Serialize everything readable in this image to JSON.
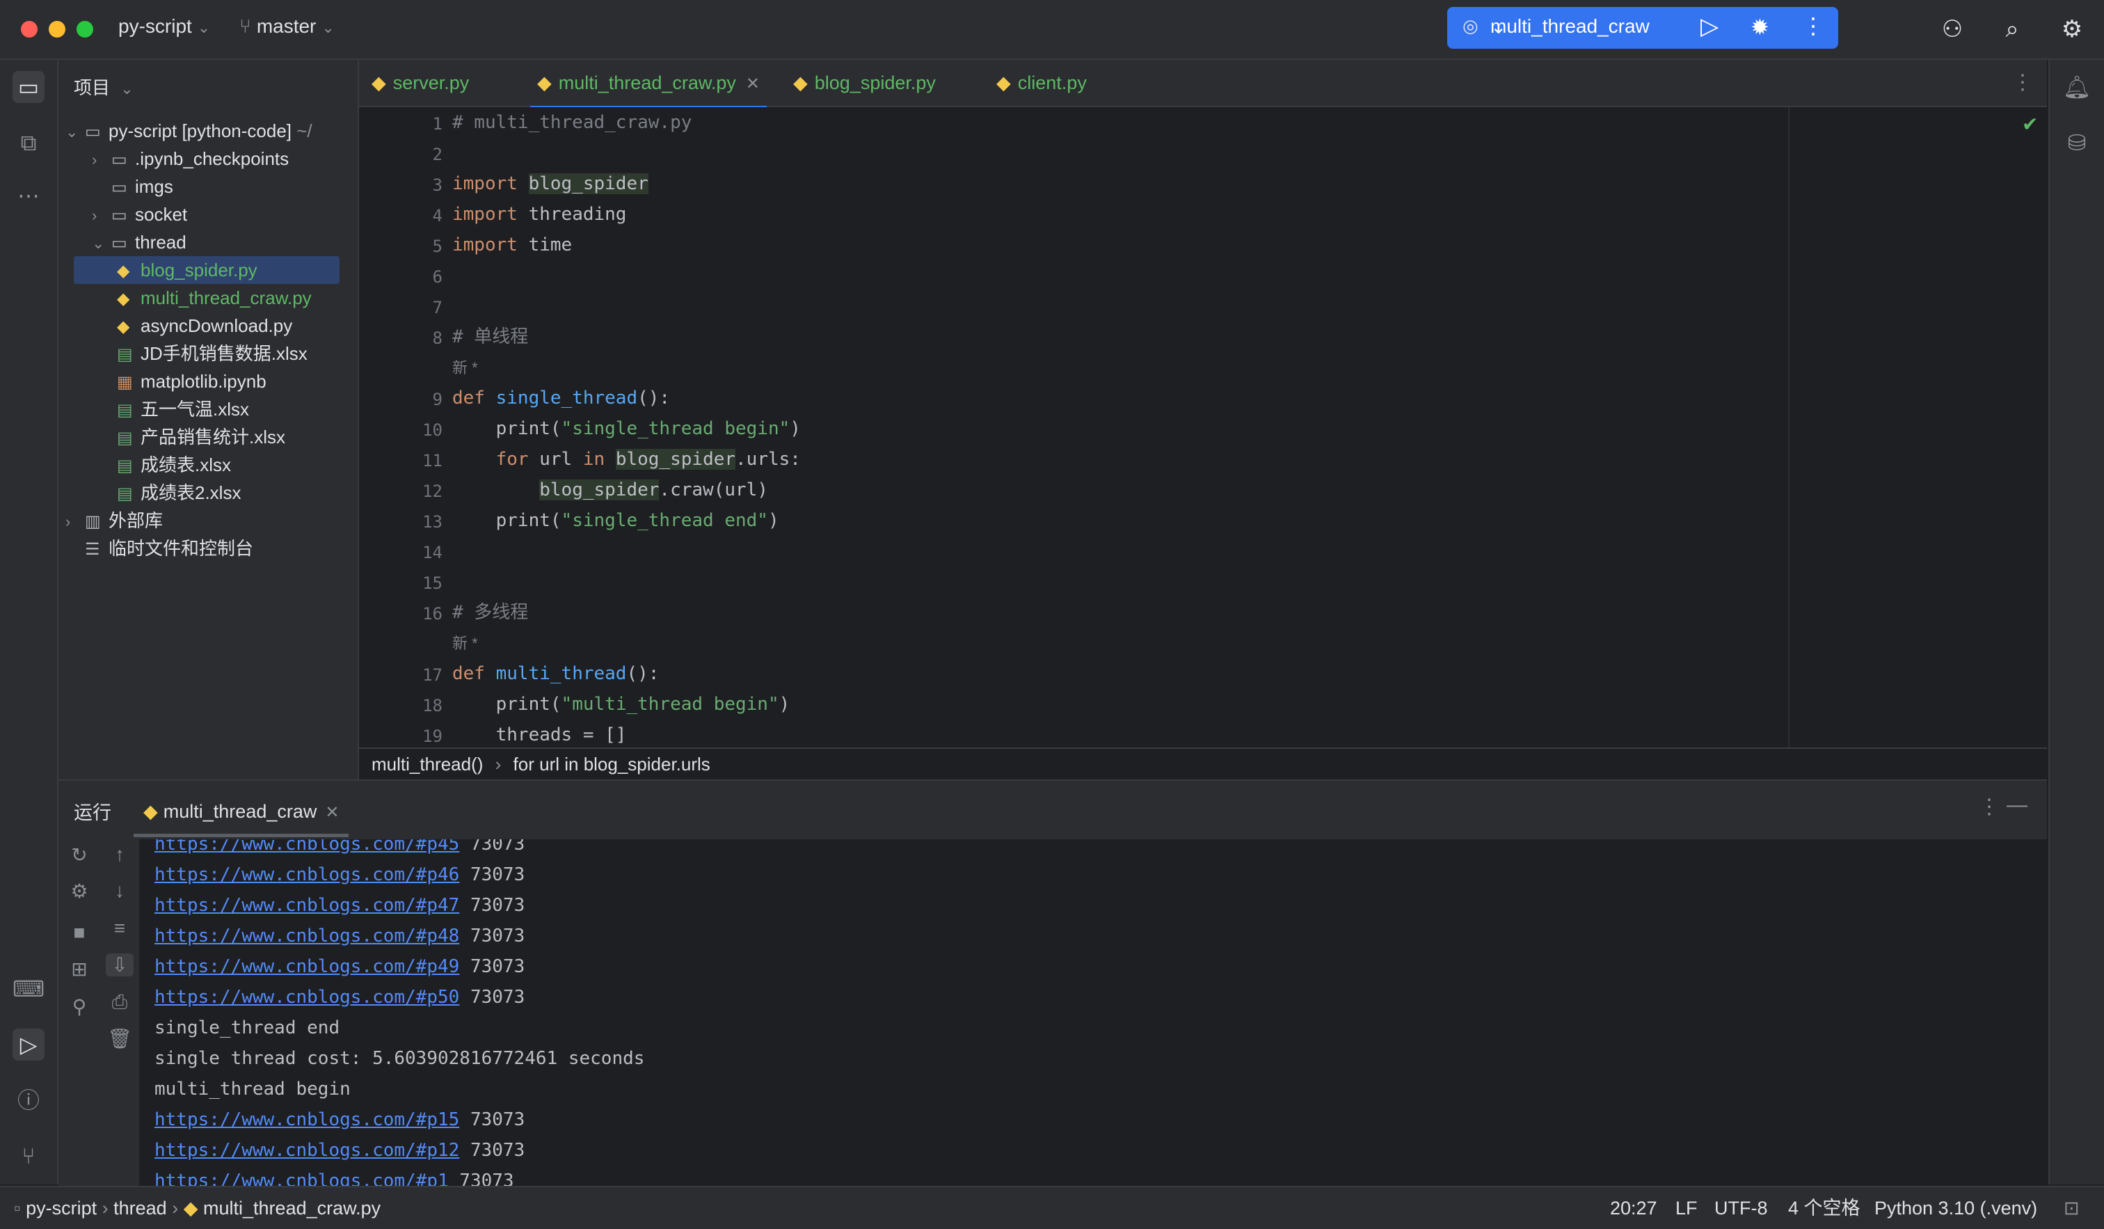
{
  "titlebar": {
    "project": "py-script",
    "branch": "master",
    "run_config": "multi_thread_craw"
  },
  "project_panel": {
    "title": "项目",
    "root_label": "py-script [python-code]",
    "root_suffix": "~/",
    "items": [
      {
        "label": ".ipynb_checkpoints"
      },
      {
        "label": "imgs"
      },
      {
        "label": "socket"
      },
      {
        "label": "thread"
      },
      {
        "label": "blog_spider.py"
      },
      {
        "label": "multi_thread_craw.py"
      },
      {
        "label": "asyncDownload.py"
      },
      {
        "label": "JD手机销售数据.xlsx"
      },
      {
        "label": "matplotlib.ipynb"
      },
      {
        "label": "五一气温.xlsx"
      },
      {
        "label": "产品销售统计.xlsx"
      },
      {
        "label": "成绩表.xlsx"
      },
      {
        "label": "成绩表2.xlsx"
      },
      {
        "label": "外部库"
      },
      {
        "label": "临时文件和控制台"
      }
    ]
  },
  "tabs": [
    {
      "label": "server.py"
    },
    {
      "label": "multi_thread_craw.py"
    },
    {
      "label": "blog_spider.py"
    },
    {
      "label": "client.py"
    }
  ],
  "editor": {
    "line_numbers": [
      "1",
      "2",
      "3",
      "4",
      "5",
      "6",
      "7",
      "8",
      "9",
      "10",
      "11",
      "12",
      "13",
      "14",
      "15",
      "16",
      "17",
      "18",
      "19"
    ],
    "hint": "新 *",
    "breadcrumb_func": "multi_thread()",
    "breadcrumb_stmt": "for url in blog_spider.urls"
  },
  "run_panel": {
    "title": "运行",
    "tab_label": "multi_thread_craw",
    "console": [
      {
        "link": "https://www.cnblogs.com/#p45",
        "text": " 73073"
      },
      {
        "link": "https://www.cnblogs.com/#p46",
        "text": " 73073"
      },
      {
        "link": "https://www.cnblogs.com/#p47",
        "text": " 73073"
      },
      {
        "link": "https://www.cnblogs.com/#p48",
        "text": " 73073"
      },
      {
        "link": "https://www.cnblogs.com/#p49",
        "text": " 73073"
      },
      {
        "link": "https://www.cnblogs.com/#p50",
        "text": " 73073"
      },
      {
        "link": "",
        "text": "single_thread end"
      },
      {
        "link": "",
        "text": "single thread cost: 5.603902816772461 seconds"
      },
      {
        "link": "",
        "text": "multi_thread begin"
      },
      {
        "link": "https://www.cnblogs.com/#p15",
        "text": " 73073"
      },
      {
        "link": "https://www.cnblogs.com/#p12",
        "text": " 73073"
      },
      {
        "link": "https://www.cnblogs.com/#p1",
        "text": " 73073"
      }
    ]
  },
  "statusbar": {
    "crumb_project": "py-script",
    "crumb_folder": "thread",
    "crumb_file": "multi_thread_craw.py",
    "position": "20:27",
    "line_ending": "LF",
    "encoding": "UTF-8",
    "indent": "4 个空格",
    "interpreter": "Python 3.10 (.venv)"
  },
  "colors": {
    "accent": "#3574f0",
    "keyword": "#cf8e6d",
    "string": "#6aab73",
    "link": "#548af7"
  }
}
